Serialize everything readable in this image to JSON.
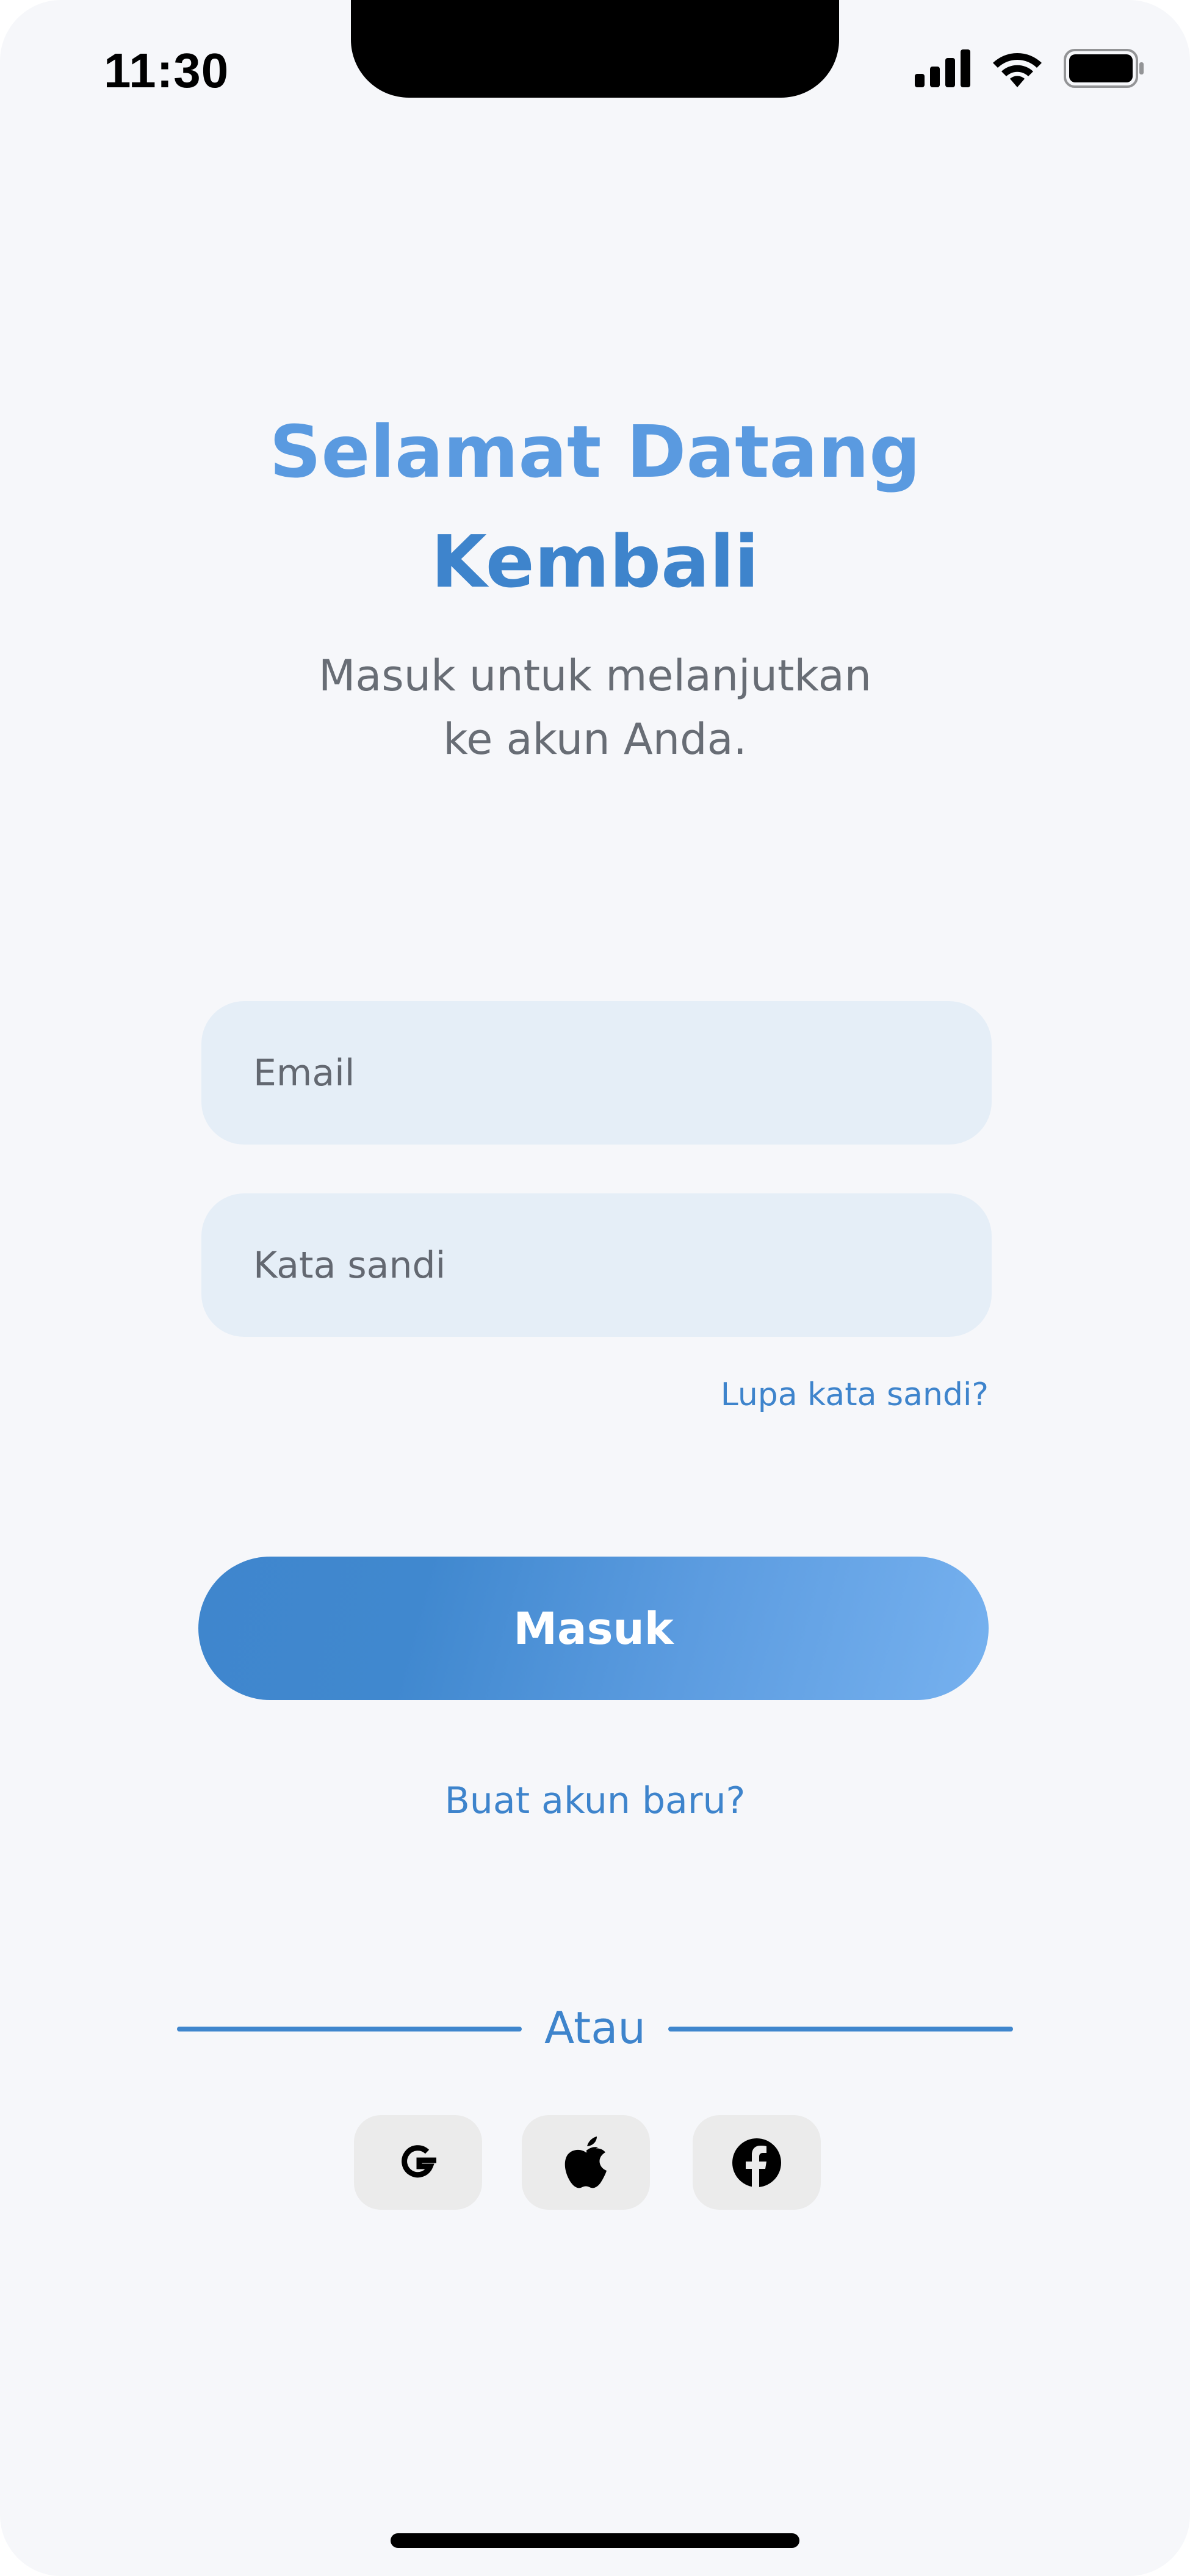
{
  "status_bar": {
    "time": "11:30",
    "icons": [
      "signal-icon",
      "wifi-icon",
      "battery-icon"
    ]
  },
  "header": {
    "title_line1": "Selamat Datang",
    "title_line2": "Kembali",
    "subtitle_line1": "Masuk untuk melanjutkan",
    "subtitle_line2": "ke akun Anda."
  },
  "form": {
    "email_placeholder": "Email",
    "password_placeholder": "Kata sandi",
    "forgot_password": "Lupa kata sandi?",
    "submit_label": "Masuk",
    "create_account": "Buat akun baru?"
  },
  "social": {
    "divider_text": "Atau",
    "providers": [
      "google-icon",
      "apple-icon",
      "facebook-icon"
    ]
  },
  "colors": {
    "accent": "#3e84cc",
    "accent_light": "#76b1ef",
    "field_bg": "#e5eef7",
    "background": "#f6f7fa",
    "social_bg": "#ebebeb"
  }
}
